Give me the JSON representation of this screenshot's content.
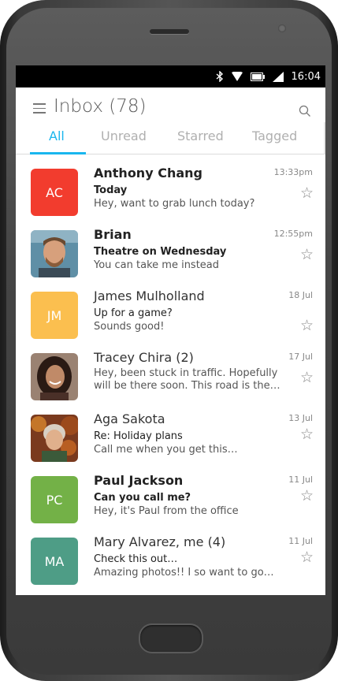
{
  "status_bar": {
    "time": "16:04"
  },
  "header": {
    "title": "Inbox (78)"
  },
  "tabs": [
    {
      "label": "All",
      "active": true
    },
    {
      "label": "Unread",
      "active": false
    },
    {
      "label": "Starred",
      "active": false
    },
    {
      "label": "Tagged",
      "active": false
    }
  ],
  "messages": [
    {
      "initials": "AC",
      "avatar_color": "#f23c2e",
      "sender": "Anthony Chang",
      "subject": "Today",
      "preview": "Hey, want to grab lunch today?",
      "time": "13:33pm",
      "unread": true
    },
    {
      "avatar_icon": "photo-man-with-beard",
      "sender": "Brian",
      "subject": "Theatre on Wednesday",
      "preview": "You can take me instead",
      "time": "12:55pm",
      "unread": true
    },
    {
      "initials": "JM",
      "avatar_color": "#fbbf4f",
      "sender": "James Mulholland",
      "subject": "Up for a game?",
      "preview": "Sounds good!",
      "time": "18 Jul",
      "unread": false
    },
    {
      "avatar_icon": "photo-woman-smiling",
      "sender": "Tracey Chira (2)",
      "subject": "",
      "preview": "Hey, been stuck in traffic. Hopefully will be there soon. This road is the…",
      "time": "17 Jul",
      "unread": false
    },
    {
      "avatar_icon": "photo-woman-autumn",
      "sender": "Aga Sakota",
      "subject": "Re: Holiday plans",
      "preview": "Call me when you get this…",
      "time": "13 Jul",
      "unread": false
    },
    {
      "initials": "PC",
      "avatar_color": "#73b147",
      "sender": "Paul Jackson",
      "subject": "Can you call me?",
      "preview": "Hey, it's Paul from the office",
      "time": "11 Jul",
      "unread": true
    },
    {
      "initials": "MA",
      "avatar_color": "#4e9d86",
      "sender": "Mary Alvarez, me (4)",
      "subject": "Check this out…",
      "preview": "Amazing photos!! I so want to go…",
      "time": "11 Jul",
      "unread": false
    }
  ]
}
